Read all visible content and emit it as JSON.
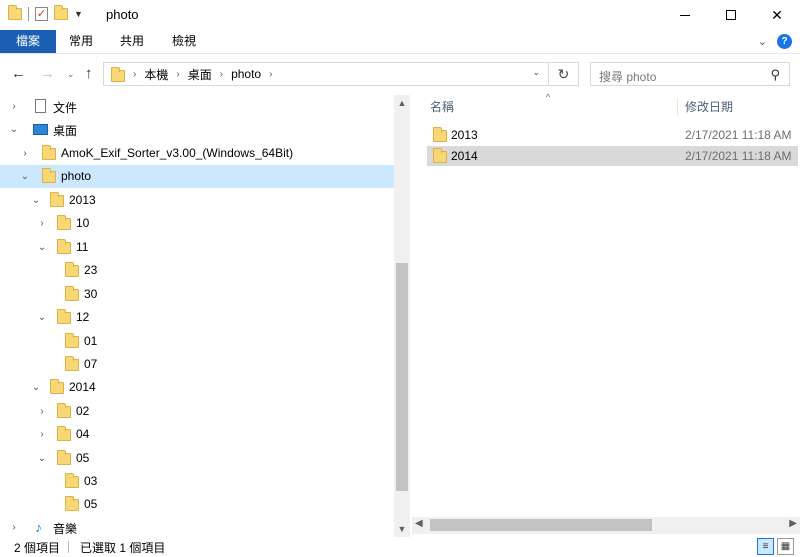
{
  "window": {
    "title": "photo",
    "minimize_icon": "minimize-icon",
    "maximize_icon": "maximize-icon",
    "close_icon": "close-icon"
  },
  "ribbon": {
    "tabs": [
      "檔案",
      "常用",
      "共用",
      "檢視"
    ],
    "accent": "#1a5fb4"
  },
  "address": {
    "crumbs": [
      "本機",
      "桌面",
      "photo"
    ],
    "search_placeholder": "搜尋 photo"
  },
  "tree": {
    "items": [
      {
        "label": "文件"
      },
      {
        "label": "桌面"
      },
      {
        "label": "AmoK_Exif_Sorter_v3.00_(Windows_64Bit)"
      },
      {
        "label": "photo"
      },
      {
        "label": "2013"
      },
      {
        "label": "10"
      },
      {
        "label": "11"
      },
      {
        "label": "23"
      },
      {
        "label": "30"
      },
      {
        "label": "12"
      },
      {
        "label": "01"
      },
      {
        "label": "07"
      },
      {
        "label": "2014"
      },
      {
        "label": "02"
      },
      {
        "label": "04"
      },
      {
        "label": "05"
      },
      {
        "label": "03"
      },
      {
        "label": "05"
      },
      {
        "label": "音樂"
      }
    ]
  },
  "content": {
    "columns": {
      "name": "名稱",
      "date": "修改日期"
    },
    "files": [
      {
        "name": "2013",
        "date": "2/17/2021 11:18 AM"
      },
      {
        "name": "2014",
        "date": "2/17/2021 11:18 AM"
      }
    ]
  },
  "status": {
    "count": "2 個項目",
    "selected": "已選取 1 個項目"
  }
}
